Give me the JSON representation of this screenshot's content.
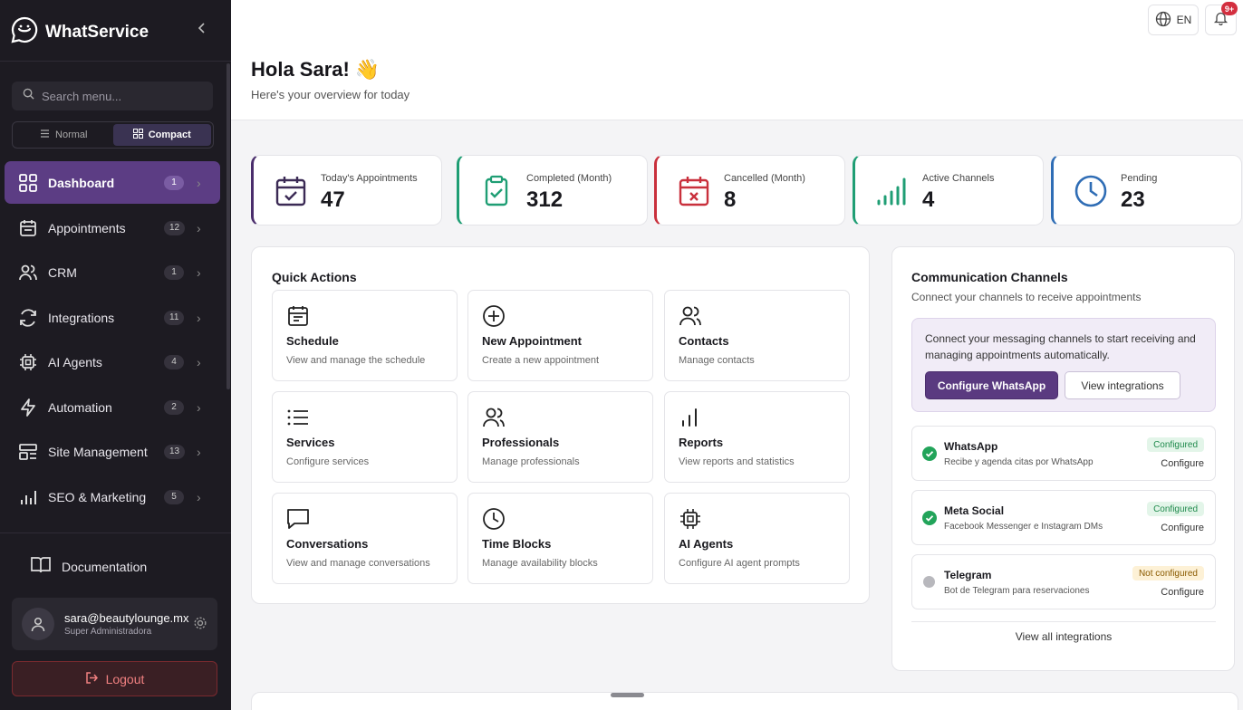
{
  "brand": {
    "name": "WhatService"
  },
  "sidebar": {
    "search_placeholder": "Search menu...",
    "modes": [
      {
        "label": "Normal"
      },
      {
        "label": "Compact"
      }
    ],
    "items": [
      {
        "label": "Dashboard",
        "count": "1",
        "icon": "dashboard-icon"
      },
      {
        "label": "Appointments",
        "count": "12",
        "icon": "calendar-icon"
      },
      {
        "label": "CRM",
        "count": "1",
        "icon": "users-icon"
      },
      {
        "label": "Integrations",
        "count": "11",
        "icon": "refresh-icon"
      },
      {
        "label": "AI Agents",
        "count": "4",
        "icon": "chip-icon"
      },
      {
        "label": "Automation",
        "count": "2",
        "icon": "lightning-icon"
      },
      {
        "label": "Site Management",
        "count": "13",
        "icon": "layout-icon"
      },
      {
        "label": "SEO & Marketing",
        "count": "5",
        "icon": "bar-chart-icon"
      }
    ],
    "documentation": "Documentation",
    "user": {
      "email": "sara@beautylounge.mx",
      "role": "Super Administradora"
    },
    "logout": "Logout"
  },
  "header": {
    "title": "Hola Sara! 👋",
    "subtitle": "Here's your overview for today",
    "language": "EN",
    "notifications_badge": "9+"
  },
  "stats": [
    {
      "label": "Today's Appointments",
      "value": "47",
      "color": "#4a2d6c"
    },
    {
      "label": "Completed (Month)",
      "value": "312",
      "color": "#1f9e74"
    },
    {
      "label": "Cancelled (Month)",
      "value": "8",
      "color": "#c9303c"
    },
    {
      "label": "Active Channels",
      "value": "4",
      "color": "#1f9e74"
    },
    {
      "label": "Pending",
      "value": "23",
      "color": "#2f6db5"
    }
  ],
  "quick_actions": {
    "title": "Quick Actions",
    "items": [
      {
        "title": "Schedule",
        "desc": "View and manage the schedule"
      },
      {
        "title": "New Appointment",
        "desc": "Create a new appointment"
      },
      {
        "title": "Contacts",
        "desc": "Manage contacts"
      },
      {
        "title": "Services",
        "desc": "Configure services"
      },
      {
        "title": "Professionals",
        "desc": "Manage professionals"
      },
      {
        "title": "Reports",
        "desc": "View reports and statistics"
      },
      {
        "title": "Conversations",
        "desc": "View and manage conversations"
      },
      {
        "title": "Time Blocks",
        "desc": "Manage availability blocks"
      },
      {
        "title": "AI Agents",
        "desc": "Configure AI agent prompts"
      }
    ]
  },
  "channels": {
    "title": "Communication Channels",
    "subtitle": "Connect your channels to receive appointments",
    "connect_message": "Connect your messaging channels to start receiving and managing appointments automatically.",
    "configure_whatsapp": "Configure WhatsApp",
    "view_integrations": "View integrations",
    "list": [
      {
        "name": "WhatsApp",
        "desc": "Recibe y agenda citas por WhatsApp",
        "status": "Configured",
        "action": "Configure"
      },
      {
        "name": "Meta Social",
        "desc": "Facebook Messenger e Instagram DMs",
        "status": "Configured",
        "action": "Configure"
      },
      {
        "name": "Telegram",
        "desc": "Bot de Telegram para reservaciones",
        "status": "Not configured",
        "action": "Configure"
      }
    ],
    "view_all": "View all integrations"
  }
}
